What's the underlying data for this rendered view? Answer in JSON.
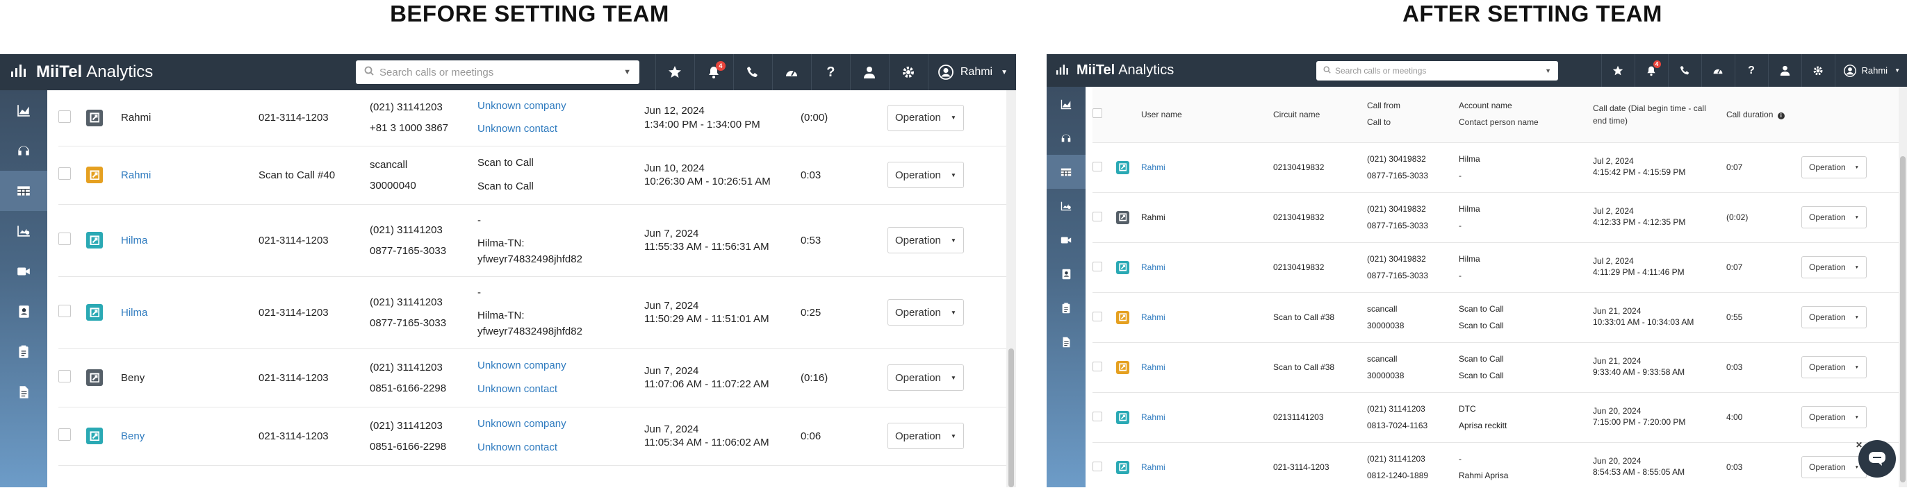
{
  "captions": {
    "before": "BEFORE SETTING TEAM",
    "after": "AFTER SETTING TEAM"
  },
  "app": {
    "logo_name": "MiiTel",
    "logo_suffix": "Analytics"
  },
  "search": {
    "placeholder": "Search calls or meetings"
  },
  "topbar": {
    "notification_count": "4",
    "user_name": "Rahmi"
  },
  "operation_label": "Operation",
  "colors": {
    "topbar": "#2b3744",
    "link": "#2f7bbf",
    "icon_teal": "#2aa9b4",
    "icon_gray": "#555f68",
    "icon_orange": "#e5a020",
    "badge": "#e8453c"
  },
  "before": {
    "rows": [
      {
        "icon": "manual",
        "user": "Rahmi",
        "user_link": false,
        "circuit": "021-3114-1203",
        "from": "(021) 31141203",
        "to": "+81 3 1000 3867",
        "account": "Unknown company",
        "account_link": true,
        "contact": [
          "Unknown contact"
        ],
        "contact_link": true,
        "date": "Jun 12, 2024",
        "time": "1:34:00 PM - 1:34:00 PM",
        "duration": "(0:00)"
      },
      {
        "icon": "scan",
        "user": "Rahmi",
        "user_link": true,
        "circuit": "Scan to Call #40",
        "from": "scancall",
        "to": "30000040",
        "account": "Scan to Call",
        "account_link": false,
        "contact": [
          "Scan to Call"
        ],
        "contact_link": false,
        "date": "Jun 10, 2024",
        "time": "10:26:30 AM - 10:26:51 AM",
        "duration": "0:03"
      },
      {
        "icon": "auto",
        "user": "Hilma",
        "user_link": true,
        "circuit": "021-3114-1203",
        "from": "(021) 31141203",
        "to": "0877-7165-3033",
        "account": "-",
        "account_link": false,
        "contact": [
          "Hilma-TN:",
          "yfweyr74832498jhfd82"
        ],
        "contact_link": false,
        "date": "Jun 7, 2024",
        "time": "11:55:33 AM - 11:56:31 AM",
        "duration": "0:53"
      },
      {
        "icon": "auto",
        "user": "Hilma",
        "user_link": true,
        "circuit": "021-3114-1203",
        "from": "(021) 31141203",
        "to": "0877-7165-3033",
        "account": "-",
        "account_link": false,
        "contact": [
          "Hilma-TN:",
          "yfweyr74832498jhfd82"
        ],
        "contact_link": false,
        "date": "Jun 7, 2024",
        "time": "11:50:29 AM - 11:51:01 AM",
        "duration": "0:25"
      },
      {
        "icon": "manual",
        "user": "Beny",
        "user_link": false,
        "circuit": "021-3114-1203",
        "from": "(021) 31141203",
        "to": "0851-6166-2298",
        "account": "Unknown company",
        "account_link": true,
        "contact": [
          "Unknown contact"
        ],
        "contact_link": true,
        "date": "Jun 7, 2024",
        "time": "11:07:06 AM - 11:07:22 AM",
        "duration": "(0:16)"
      },
      {
        "icon": "auto",
        "user": "Beny",
        "user_link": true,
        "circuit": "021-3114-1203",
        "from": "(021) 31141203",
        "to": "0851-6166-2298",
        "account": "Unknown company",
        "account_link": true,
        "contact": [
          "Unknown contact"
        ],
        "contact_link": true,
        "date": "Jun 7, 2024",
        "time": "11:05:34 AM - 11:06:02 AM",
        "duration": "0:06"
      }
    ]
  },
  "after": {
    "headers": {
      "user": "User name",
      "circuit": "Circuit name",
      "call_from": "Call from",
      "call_to": "Call to",
      "account": "Account name",
      "contact": "Contact person name",
      "date_line1": "Call date (Dial begin time - call",
      "date_line2": "end time)",
      "duration": "Call duration"
    },
    "rows": [
      {
        "icon": "auto",
        "user": "Rahmi",
        "user_link": true,
        "circuit": "02130419832",
        "from": "(021) 30419832",
        "to": "0877-7165-3033",
        "account": "Hilma",
        "contact": "-",
        "date": "Jul 2, 2024",
        "time": "4:15:42 PM - 4:15:59 PM",
        "duration": "0:07"
      },
      {
        "icon": "manual",
        "user": "Rahmi",
        "user_link": false,
        "circuit": "02130419832",
        "from": "(021) 30419832",
        "to": "0877-7165-3033",
        "account": "Hilma",
        "contact": "-",
        "date": "Jul 2, 2024",
        "time": "4:12:33 PM - 4:12:35 PM",
        "duration": "(0:02)"
      },
      {
        "icon": "auto",
        "user": "Rahmi",
        "user_link": true,
        "circuit": "02130419832",
        "from": "(021) 30419832",
        "to": "0877-7165-3033",
        "account": "Hilma",
        "contact": "-",
        "date": "Jul 2, 2024",
        "time": "4:11:29 PM - 4:11:46 PM",
        "duration": "0:07"
      },
      {
        "icon": "scan",
        "user": "Rahmi",
        "user_link": true,
        "circuit": "Scan to Call #38",
        "from": "scancall",
        "to": "30000038",
        "account": "Scan to Call",
        "contact": "Scan to Call",
        "date": "Jun 21, 2024",
        "time": "10:33:01 AM - 10:34:03 AM",
        "duration": "0:55"
      },
      {
        "icon": "scan",
        "user": "Rahmi",
        "user_link": true,
        "circuit": "Scan to Call #38",
        "from": "scancall",
        "to": "30000038",
        "account": "Scan to Call",
        "contact": "Scan to Call",
        "date": "Jun 21, 2024",
        "time": "9:33:40 AM - 9:33:58 AM",
        "duration": "0:03"
      },
      {
        "icon": "auto",
        "user": "Rahmi",
        "user_link": true,
        "circuit": "02131141203",
        "from": "(021) 31141203",
        "to": "0813-7024-1163",
        "account": "DTC",
        "contact": "Aprisa reckitt",
        "date": "Jun 20, 2024",
        "time": "7:15:00 PM - 7:20:00 PM",
        "duration": "4:00"
      },
      {
        "icon": "auto",
        "user": "Rahmi",
        "user_link": true,
        "circuit": "021-3114-1203",
        "from": "(021) 31141203",
        "to": "0812-1240-1889",
        "account": "-",
        "contact": "Rahmi Aprisa",
        "date": "Jun 20, 2024",
        "time": "8:54:53 AM - 8:55:05 AM",
        "duration": "0:03"
      }
    ]
  },
  "sidebar_items": [
    "chart-area-icon",
    "headset-icon",
    "table-icon",
    "chart-user-icon",
    "video-icon",
    "contact-book-icon",
    "clipboard-icon",
    "document-icon"
  ]
}
